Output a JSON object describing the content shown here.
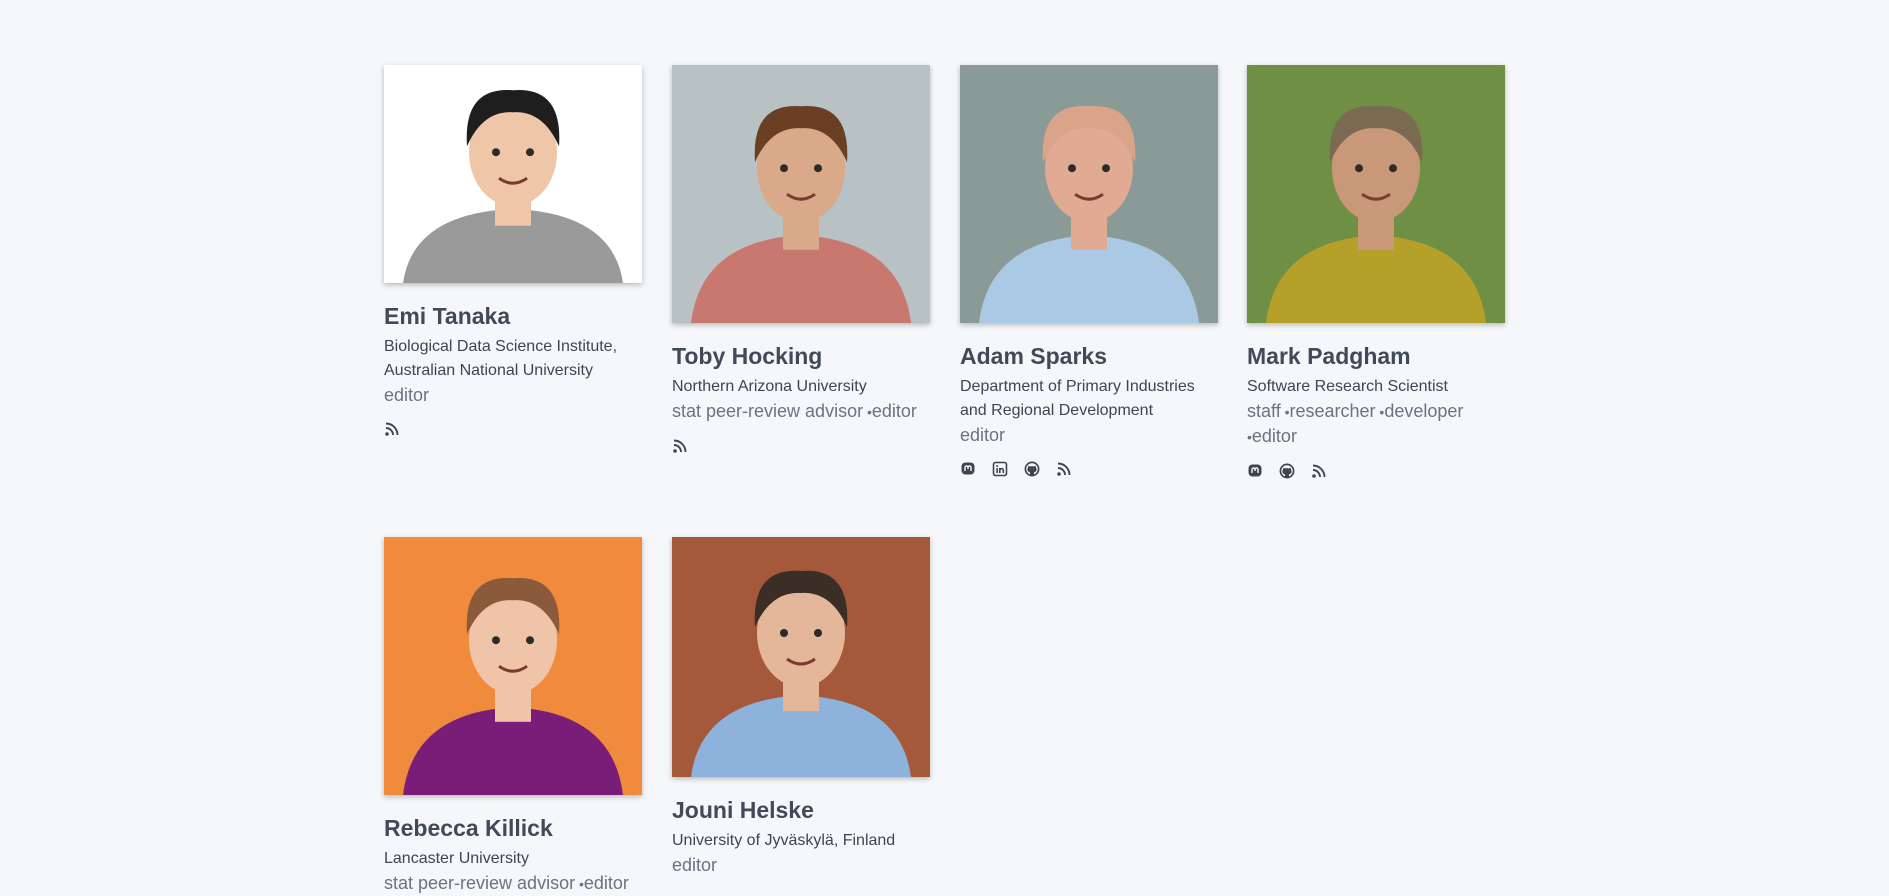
{
  "people": [
    {
      "name": "Emi Tanaka",
      "affiliation": "Biological Data Science Institute, Australian National University",
      "roles": [
        "editor"
      ],
      "socials": [
        "rss-icon"
      ],
      "photo": {
        "bg": "#ffffff",
        "shirt": "#9a9a9a",
        "hair": "#1e1e1e",
        "skin": "#efc6a8"
      }
    },
    {
      "name": "Toby Hocking",
      "affiliation": "Northern Arizona University",
      "roles": [
        "stat peer-review advisor",
        "editor"
      ],
      "socials": [
        "rss-icon"
      ],
      "photo": {
        "bg": "#b8c2c4",
        "shirt": "#c97870",
        "hair": "#6a3f24",
        "skin": "#d9a98a"
      }
    },
    {
      "name": "Adam Sparks",
      "affiliation": "Department of Primary Industries and Regional Development",
      "roles": [
        "editor"
      ],
      "socials": [
        "mastodon-icon",
        "linkedin-icon",
        "github-icon",
        "rss-icon"
      ],
      "photo": {
        "bg": "#8a9a97",
        "shirt": "#a9c9e4",
        "hair": "#d9a48a",
        "skin": "#e0ab92"
      }
    },
    {
      "name": "Mark Padgham",
      "affiliation": "Software Research Scientist",
      "roles": [
        "staff",
        "researcher",
        "developer",
        "editor"
      ],
      "socials": [
        "mastodon-icon",
        "github-icon",
        "rss-icon"
      ],
      "photo": {
        "bg": "#6f8f45",
        "shirt": "#b5a12a",
        "hair": "#7b6a52",
        "skin": "#c99878"
      }
    },
    {
      "name": "Rebecca Killick",
      "affiliation": "Lancaster University",
      "roles": [
        "stat peer-review advisor",
        "editor"
      ],
      "socials": [],
      "photo": {
        "bg": "#f08a3c",
        "shirt": "#7a1d78",
        "hair": "#8a5a3a",
        "skin": "#efc4a8"
      }
    },
    {
      "name": "Jouni Helske",
      "affiliation": "University of Jyväskylä, Finland",
      "roles": [
        "editor"
      ],
      "socials": [],
      "photo": {
        "bg": "#a5583a",
        "shirt": "#8db3dc",
        "hair": "#3a2e26",
        "skin": "#e4b79a"
      }
    }
  ],
  "colors": {
    "page_bg": "#f5f7fb",
    "name": "#424a57",
    "role": "#6b7280"
  }
}
